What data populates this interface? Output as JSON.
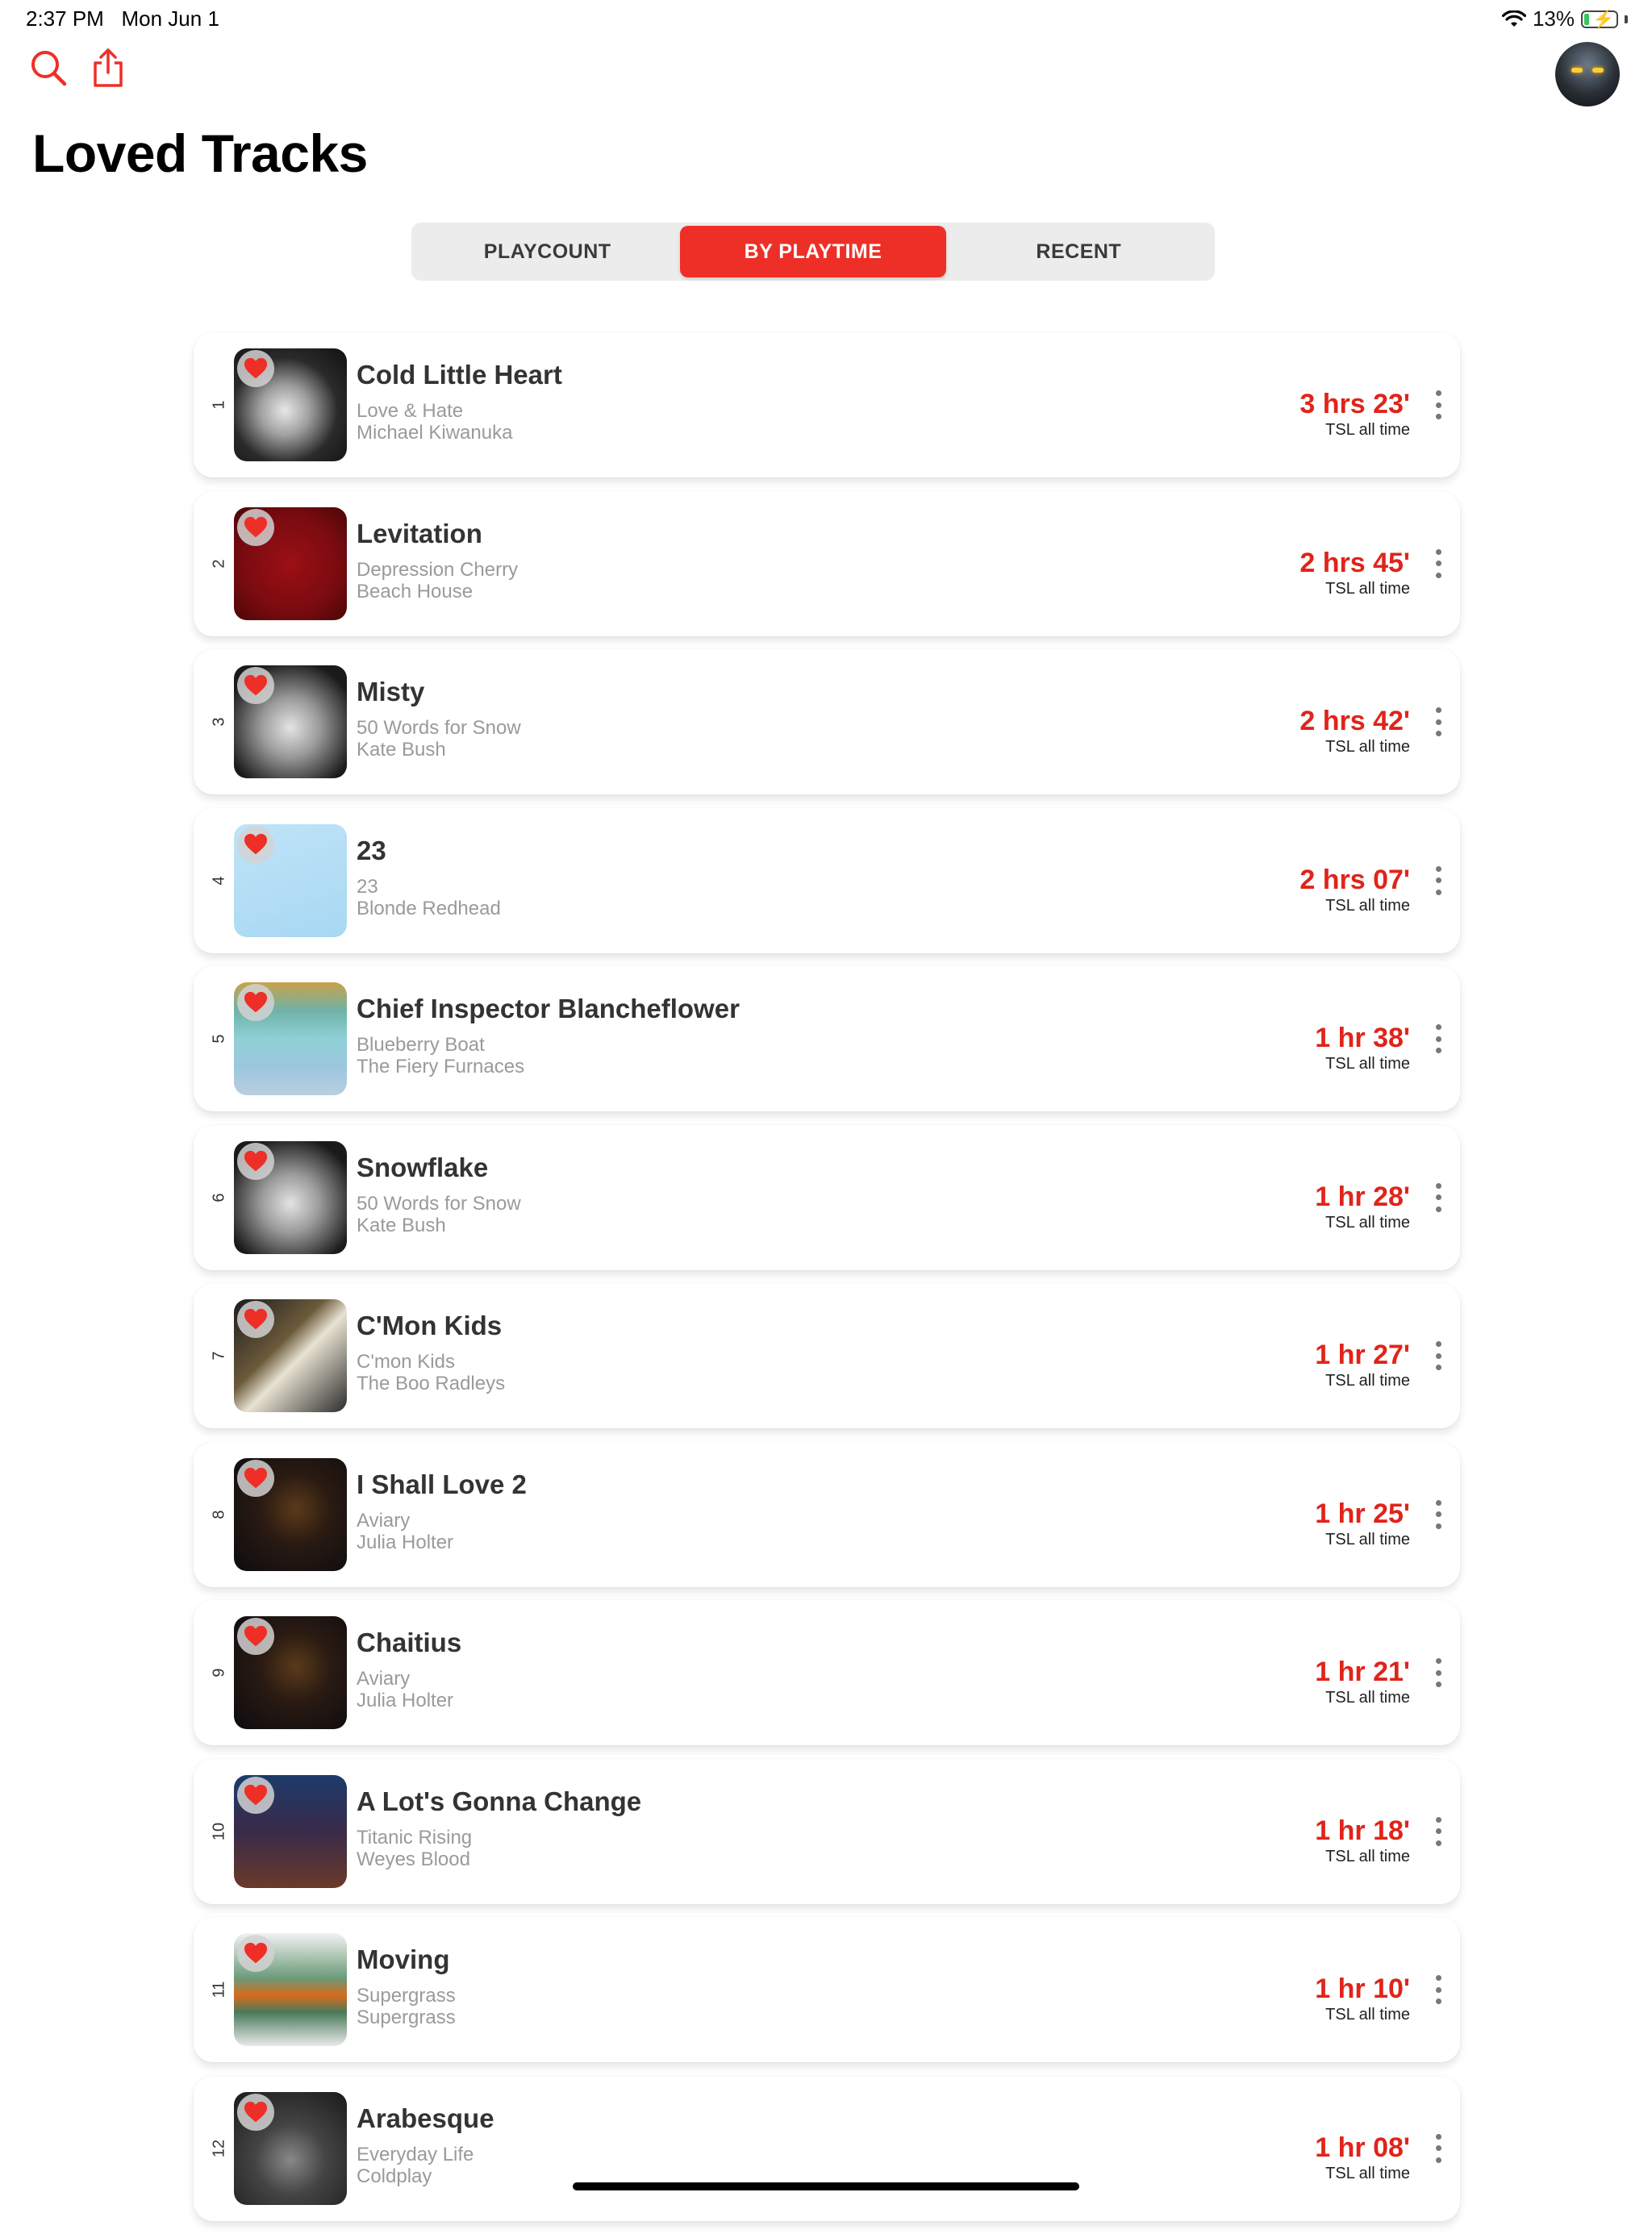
{
  "status_bar": {
    "time": "2:37 PM",
    "date": "Mon Jun 1",
    "battery": "13%"
  },
  "toolbar": {
    "search_icon": "search-icon",
    "share_icon": "share-icon"
  },
  "page": {
    "title": "Loved Tracks"
  },
  "segments": [
    {
      "label": "PLAYCOUNT",
      "active": false
    },
    {
      "label": "BY PLAYTIME",
      "active": true
    },
    {
      "label": "RECENT",
      "active": false
    }
  ],
  "colors": {
    "accent": "#ee2f27",
    "playtime": "#e0241a",
    "secondary_text": "#9a9a9a"
  },
  "tracks": [
    {
      "rank": "1",
      "title": "Cold Little Heart",
      "album": "Love & Hate",
      "artist": "Michael Kiwanuka",
      "playtime": "3 hrs 23'",
      "subtitle": "TSL all time"
    },
    {
      "rank": "2",
      "title": "Levitation",
      "album": "Depression Cherry",
      "artist": "Beach House",
      "playtime": "2 hrs 45'",
      "subtitle": "TSL all time"
    },
    {
      "rank": "3",
      "title": "Misty",
      "album": "50 Words for Snow",
      "artist": "Kate Bush",
      "playtime": "2 hrs 42'",
      "subtitle": "TSL all time"
    },
    {
      "rank": "4",
      "title": "23",
      "album": "23",
      "artist": "Blonde Redhead",
      "playtime": "2 hrs 07'",
      "subtitle": "TSL all time"
    },
    {
      "rank": "5",
      "title": "Chief Inspector Blancheflower",
      "album": "Blueberry Boat",
      "artist": "The Fiery Furnaces",
      "playtime": "1 hr 38'",
      "subtitle": "TSL all time"
    },
    {
      "rank": "6",
      "title": "Snowflake",
      "album": "50 Words for Snow",
      "artist": "Kate Bush",
      "playtime": "1 hr 28'",
      "subtitle": "TSL all time"
    },
    {
      "rank": "7",
      "title": "C'Mon Kids",
      "album": "C'mon Kids",
      "artist": "The Boo Radleys",
      "playtime": "1 hr 27'",
      "subtitle": "TSL all time"
    },
    {
      "rank": "8",
      "title": "I Shall Love 2",
      "album": "Aviary",
      "artist": "Julia Holter",
      "playtime": "1 hr 25'",
      "subtitle": "TSL all time"
    },
    {
      "rank": "9",
      "title": "Chaitius",
      "album": "Aviary",
      "artist": "Julia Holter",
      "playtime": "1 hr 21'",
      "subtitle": "TSL all time"
    },
    {
      "rank": "10",
      "title": "A Lot's Gonna Change",
      "album": "Titanic Rising",
      "artist": "Weyes Blood",
      "playtime": "1 hr 18'",
      "subtitle": "TSL all time"
    },
    {
      "rank": "11",
      "title": "Moving",
      "album": "Supergrass",
      "artist": "Supergrass",
      "playtime": "1 hr 10'",
      "subtitle": "TSL all time"
    },
    {
      "rank": "12",
      "title": "Arabesque",
      "album": "Everyday Life",
      "artist": "Coldplay",
      "playtime": "1 hr 08'",
      "subtitle": "TSL all time"
    }
  ]
}
